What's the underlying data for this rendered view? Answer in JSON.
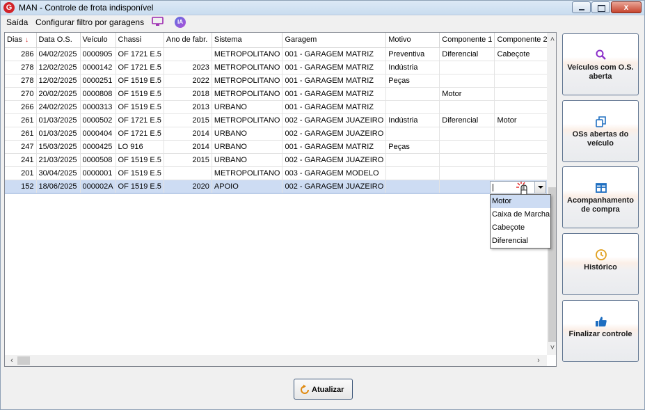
{
  "window": {
    "title": "MAN - Controle de frota indisponível",
    "app_icon": "G",
    "close_label": "x"
  },
  "menu": {
    "exit_label": "Saída",
    "filter_label": "Configurar filtro por garagens",
    "ia_label": "IA"
  },
  "grid": {
    "columns": [
      "Dias",
      "Data O.S.",
      "Veículo",
      "Chassi",
      "Ano de fabr.",
      "Sistema",
      "Garagem",
      "Motivo",
      "Componente 1",
      "Componente 2"
    ],
    "sort_column": "Dias",
    "sort_indicator": "↓",
    "rows": [
      [
        "286",
        "04/02/2025",
        "0000905",
        "OF 1721 E.5",
        "",
        "METROPOLITANO",
        "001 - GARAGEM MATRIZ",
        "Preventiva",
        "Diferencial",
        "Cabeçote"
      ],
      [
        "278",
        "12/02/2025",
        "0000142",
        "OF 1721 E.5",
        "2023",
        "METROPOLITANO",
        "001 - GARAGEM MATRIZ",
        "Indústria",
        "",
        ""
      ],
      [
        "278",
        "12/02/2025",
        "0000251",
        "OF 1519 E.5",
        "2022",
        "METROPOLITANO",
        "001 - GARAGEM MATRIZ",
        "Peças",
        "",
        ""
      ],
      [
        "270",
        "20/02/2025",
        "0000808",
        "OF 1519 E.5",
        "2018",
        "METROPOLITANO",
        "001 - GARAGEM MATRIZ",
        "",
        "Motor",
        ""
      ],
      [
        "266",
        "24/02/2025",
        "0000313",
        "OF 1519 E.5",
        "2013",
        "URBANO",
        "001 - GARAGEM MATRIZ",
        "",
        "",
        ""
      ],
      [
        "261",
        "01/03/2025",
        "0000502",
        "OF 1721 E.5",
        "2015",
        "METROPOLITANO",
        "002 - GARAGEM JUAZEIRO",
        "Indústria",
        "Diferencial",
        "Motor"
      ],
      [
        "261",
        "01/03/2025",
        "0000404",
        "OF 1721 E.5",
        "2014",
        "URBANO",
        "002 - GARAGEM JUAZEIRO",
        "",
        "",
        ""
      ],
      [
        "247",
        "15/03/2025",
        "0000425",
        "LO 916",
        "2014",
        "URBANO",
        "001 - GARAGEM MATRIZ",
        "Peças",
        "",
        ""
      ],
      [
        "241",
        "21/03/2025",
        "0000508",
        "OF 1519 E.5",
        "2015",
        "URBANO",
        "002 - GARAGEM JUAZEIRO",
        "",
        "",
        ""
      ],
      [
        "201",
        "30/04/2025",
        "0000001",
        "OF 1519 E.5",
        "",
        "METROPOLITANO",
        "003 - GARAGEM MODELO",
        "",
        "",
        ""
      ],
      [
        "152",
        "18/06/2025",
        "000002A",
        "OF 1519 E.5",
        "2020",
        "APOIO",
        "002 - GARAGEM JUAZEIRO",
        "",
        "",
        ""
      ]
    ],
    "selected_row": 10,
    "editor": {
      "column": "Componente 2",
      "value": ""
    },
    "dropdown_options": [
      "Motor",
      "Caixa de Marcha",
      "Cabeçote",
      "Diferencial"
    ],
    "dropdown_highlighted": "Motor"
  },
  "side_buttons": [
    {
      "label": "Veículos com O.S. aberta",
      "icon": "search-icon",
      "color": "#8b2fc9"
    },
    {
      "label": "OSs abertas do veículo",
      "icon": "copy-icon",
      "color": "#1f6fc1"
    },
    {
      "label": "Acompanhamento de compra",
      "icon": "table-icon",
      "color": "#1f6fc1"
    },
    {
      "label": "Histórico",
      "icon": "clock-icon",
      "color": "#e0a020"
    },
    {
      "label": "Finalizar controle",
      "icon": "thumbs-up-icon",
      "color": "#1f6fc1"
    }
  ],
  "footer": {
    "refresh_label": "Atualizar",
    "refresh_icon_color": "#e08a10"
  }
}
